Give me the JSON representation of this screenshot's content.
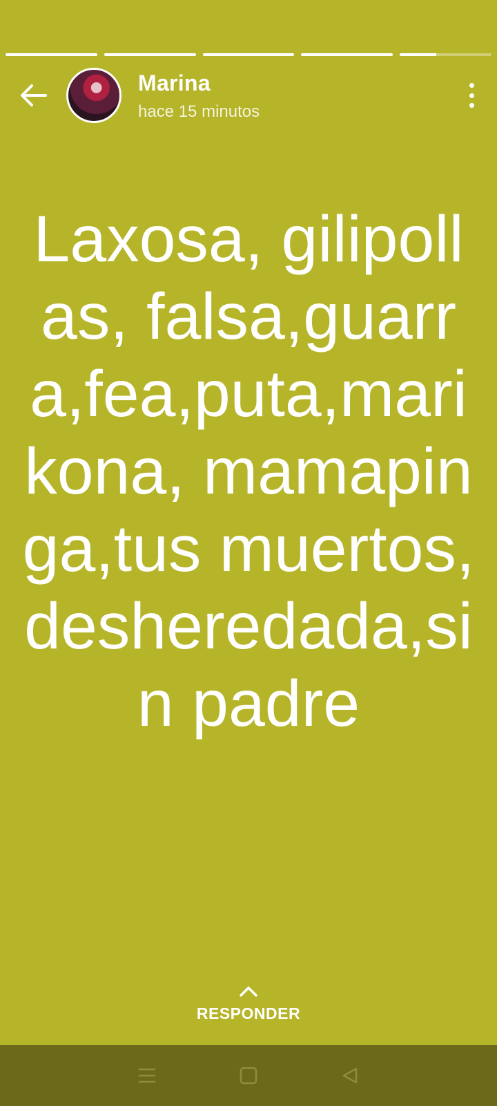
{
  "story": {
    "progress": [
      1,
      1,
      1,
      1,
      0.4
    ],
    "author": "Marina",
    "timestamp": "hace 15 minutos",
    "text": "Laxosa, gilipollas, falsa,guarra,fea,puta,marikona, mamapinga,tus muertos, desheredada,sin padre",
    "background_color": "#b6b428"
  },
  "reply": {
    "label": "RESPONDER"
  },
  "icons": {
    "back": "arrow-left-icon",
    "more": "more-vertical-icon",
    "reply": "chevron-up-icon",
    "nav_menu": "menu-icon",
    "nav_home": "square-icon",
    "nav_back": "triangle-back-icon"
  }
}
